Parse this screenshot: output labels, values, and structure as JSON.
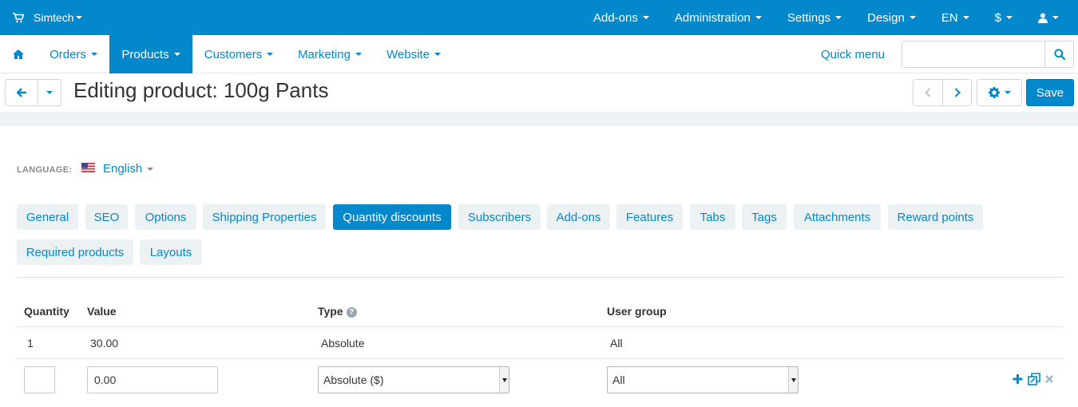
{
  "topbar": {
    "store_name": "Simtech",
    "menus": [
      "Add-ons",
      "Administration",
      "Settings",
      "Design",
      "EN",
      "$"
    ]
  },
  "nav": {
    "items": [
      "Orders",
      "Products",
      "Customers",
      "Marketing",
      "Website"
    ],
    "active": "Products",
    "quick_menu": "Quick menu",
    "search_value": ""
  },
  "header": {
    "title": "Editing product: 100g Pants",
    "save_label": "Save"
  },
  "language": {
    "label": "LANGUAGE:",
    "value": "English"
  },
  "tabs": {
    "items": [
      "General",
      "SEO",
      "Options",
      "Shipping Properties",
      "Quantity discounts",
      "Subscribers",
      "Add-ons",
      "Features",
      "Tabs",
      "Tags",
      "Attachments",
      "Reward points",
      "Required products",
      "Layouts"
    ],
    "active": "Quantity discounts"
  },
  "table": {
    "headers": {
      "quantity": "Quantity",
      "value": "Value",
      "type": "Type",
      "user_group": "User group"
    },
    "rows": [
      {
        "quantity": "1",
        "value": "30.00",
        "type": "Absolute",
        "user_group": "All"
      }
    ],
    "new_row": {
      "quantity": "",
      "value": "0.00",
      "type": "Absolute ($)",
      "user_group": "All"
    }
  },
  "colors": {
    "primary": "#0388cc",
    "tab_bg": "#ecf1f4"
  }
}
